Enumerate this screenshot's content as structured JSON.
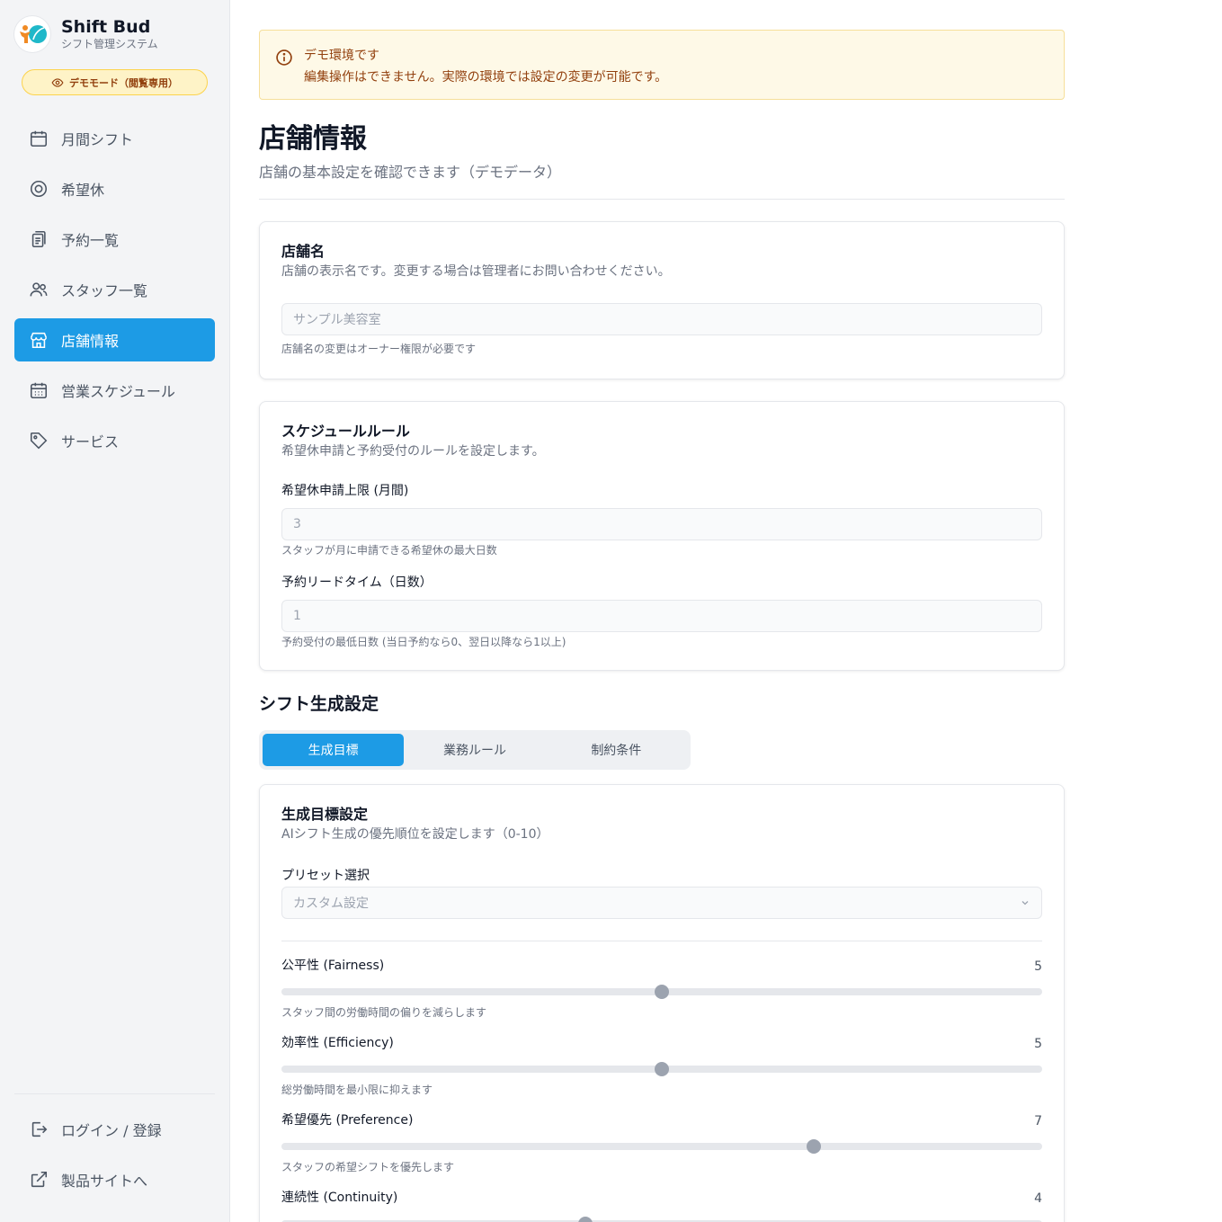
{
  "app": {
    "name": "Shift Bud",
    "subtitle": "シフト管理システム",
    "demo_badge": "デモモード（閲覧専用）"
  },
  "nav": {
    "items": [
      {
        "label": "月間シフト",
        "icon": "calendar-icon",
        "active": false
      },
      {
        "label": "希望休",
        "icon": "target-icon",
        "active": false
      },
      {
        "label": "予約一覧",
        "icon": "clipboard-icon",
        "active": false
      },
      {
        "label": "スタッフ一覧",
        "icon": "users-icon",
        "active": false
      },
      {
        "label": "店舗情報",
        "icon": "store-icon",
        "active": true
      },
      {
        "label": "営業スケジュール",
        "icon": "calendar-days-icon",
        "active": false
      },
      {
        "label": "サービス",
        "icon": "tag-icon",
        "active": false
      }
    ],
    "bottom": [
      {
        "label": "ログイン / 登録",
        "icon": "login-icon"
      },
      {
        "label": "製品サイトへ",
        "icon": "external-link-icon"
      }
    ]
  },
  "banner": {
    "title": "デモ環境です",
    "description": "編集操作はできません。実際の環境では設定の変更が可能です。"
  },
  "page": {
    "title": "店舗情報",
    "subtitle": "店舗の基本設定を確認できます（デモデータ）"
  },
  "store_card": {
    "title": "店舗名",
    "description": "店舗の表示名です。変更する場合は管理者にお問い合わせください。",
    "input_value": "サンプル美容室",
    "hint": "店舗名の変更はオーナー権限が必要です"
  },
  "schedule_card": {
    "title": "スケジュールルール",
    "description": "希望休申請と予約受付のルールを設定します。",
    "fields": [
      {
        "label": "希望休申請上限 (月間)",
        "value": "3",
        "hint": "スタッフが月に申請できる希望休の最大日数"
      },
      {
        "label": "予約リードタイム（日数）",
        "value": "1",
        "hint": "予約受付の最低日数 (当日予約なら0、翌日以降なら1以上)"
      }
    ]
  },
  "shift": {
    "title": "シフト生成設定",
    "tabs": [
      {
        "label": "生成目標",
        "active": true
      },
      {
        "label": "業務ルール",
        "active": false
      },
      {
        "label": "制約条件",
        "active": false
      }
    ]
  },
  "goal_card": {
    "title": "生成目標設定",
    "description": "AIシフト生成の優先順位を設定します（0-10）",
    "preset_label": "プリセット選択",
    "preset_value": "カスタム設定",
    "sliders": [
      {
        "label": "公平性 (Fairness)",
        "value": "5",
        "fraction": 0.5,
        "hint": "スタッフ間の労働時間の偏りを減らします"
      },
      {
        "label": "効率性 (Efficiency)",
        "value": "5",
        "fraction": 0.5,
        "hint": "総労働時間を最小限に抑えます"
      },
      {
        "label": "希望優先 (Preference)",
        "value": "7",
        "fraction": 0.7,
        "hint": "スタッフの希望シフトを優先します"
      },
      {
        "label": "連続性 (Continuity)",
        "value": "4",
        "fraction": 0.4,
        "hint": ""
      }
    ]
  },
  "colors": {
    "accent": "#1d9be5",
    "warning_bg": "#fef9e7",
    "warning_text": "#92400e"
  }
}
